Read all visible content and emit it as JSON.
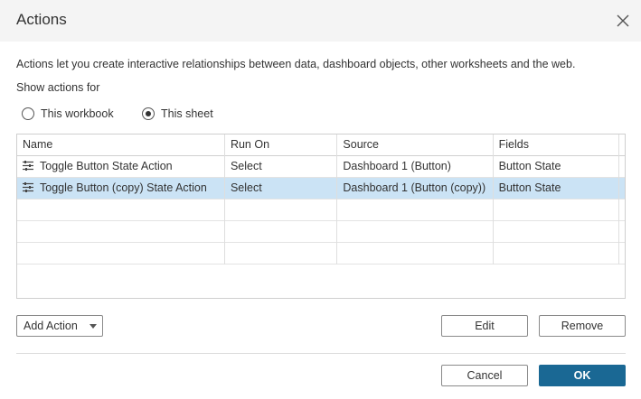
{
  "dialog": {
    "title": "Actions",
    "description": "Actions let you create interactive relationships between data, dashboard objects, other worksheets and the web.",
    "show_actions_for": "Show actions for"
  },
  "scope": {
    "options": [
      {
        "label": "This workbook",
        "checked": false
      },
      {
        "label": "This sheet",
        "checked": true
      }
    ]
  },
  "table": {
    "columns": [
      "Name",
      "Run On",
      "Source",
      "Fields"
    ],
    "rows": [
      {
        "name": "Toggle Button State Action",
        "run_on": "Select",
        "source": "Dashboard 1 (Button)",
        "fields": "Button State",
        "selected": false
      },
      {
        "name": "Toggle Button (copy) State Action",
        "run_on": "Select",
        "source": "Dashboard 1 (Button (copy))",
        "fields": "Button State",
        "selected": true
      }
    ]
  },
  "buttons": {
    "add_action": "Add Action",
    "edit": "Edit",
    "remove": "Remove",
    "cancel": "Cancel",
    "ok": "OK"
  },
  "colors": {
    "selected_row": "#cbe3f5",
    "primary_button": "#1a6894",
    "titlebar": "#f4f4f4"
  },
  "icons": {
    "close": "close-icon",
    "action": "action-filter-icon",
    "dropdown": "chevron-down-icon"
  }
}
